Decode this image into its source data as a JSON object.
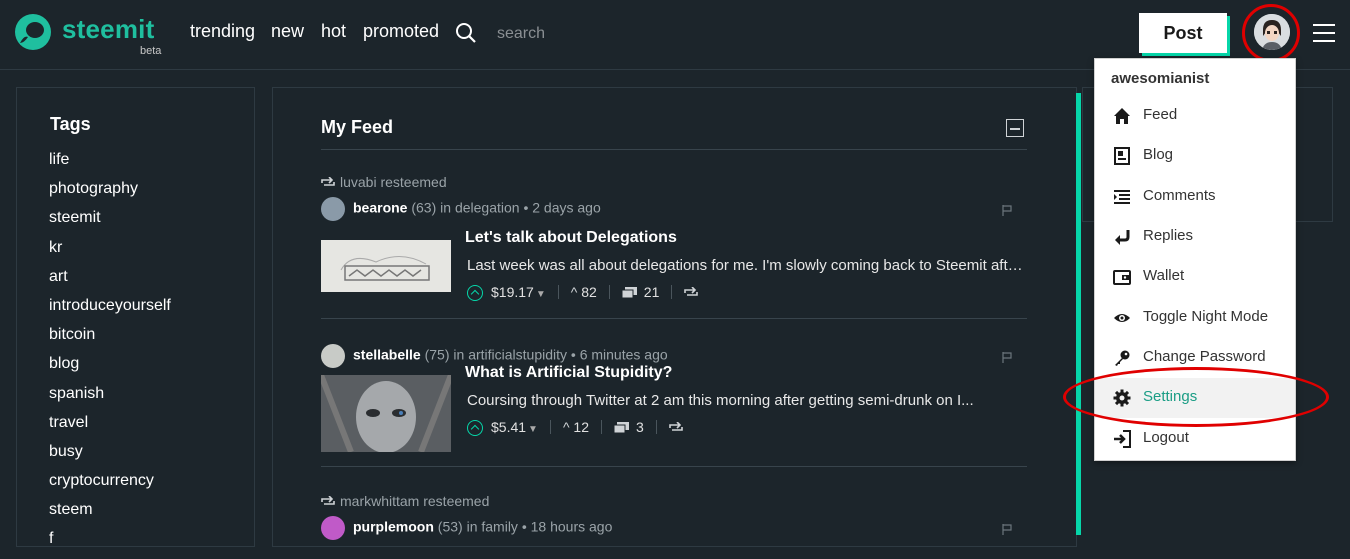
{
  "header": {
    "logo_text": "steemit",
    "logo_beta": "beta",
    "nav": [
      "trending",
      "new",
      "hot",
      "promoted"
    ],
    "search_placeholder": "search",
    "post_label": "Post",
    "brand_color": "#1fbf9f",
    "accent_color": "#06d6a9"
  },
  "tags": {
    "title": "Tags",
    "items": [
      "life",
      "photography",
      "steemit",
      "kr",
      "art",
      "introduceyourself",
      "bitcoin",
      "blog",
      "spanish",
      "travel",
      "busy",
      "cryptocurrency",
      "steem",
      "f"
    ]
  },
  "feed": {
    "title": "My Feed",
    "posts": [
      {
        "resteemed_by": "luvabi resteemed",
        "author": "bearone",
        "reputation": "(63)",
        "category_prefix": "in",
        "category": "delegation",
        "time": "• 2 days ago",
        "title": "Let's talk about Delegations",
        "summary": "Last week was all about delegations for me. I'm slowly coming back to Steemit after a longer break...",
        "payout": "$19.17",
        "votes": "82",
        "comments": "21"
      },
      {
        "resteemed_by": "",
        "author": "stellabelle",
        "reputation": "(75)",
        "category_prefix": "in",
        "category": "artificialstupidity",
        "time": "• 6 minutes ago",
        "title": "What is Artificial Stupidity?",
        "summary": "Coursing through Twitter at 2 am this morning after getting semi-drunk on I...",
        "payout": "$5.41",
        "votes": "12",
        "comments": "3"
      },
      {
        "resteemed_by": "markwhittam resteemed",
        "author": "purplemoon",
        "reputation": "(53)",
        "category_prefix": "in",
        "category": "family",
        "time": "• 18 hours ago"
      }
    ]
  },
  "user_menu": {
    "username": "awesomianist",
    "items": [
      {
        "label": "Feed",
        "icon": "home-icon"
      },
      {
        "label": "Blog",
        "icon": "blog-icon"
      },
      {
        "label": "Comments",
        "icon": "comments-icon"
      },
      {
        "label": "Replies",
        "icon": "reply-icon"
      },
      {
        "label": "Wallet",
        "icon": "wallet-icon"
      },
      {
        "label": "Toggle Night Mode",
        "icon": "eye-icon"
      },
      {
        "label": "Change Password",
        "icon": "key-icon"
      },
      {
        "label": "Settings",
        "icon": "gear-icon"
      },
      {
        "label": "Logout",
        "icon": "logout-icon"
      }
    ],
    "active_item": "Settings"
  }
}
